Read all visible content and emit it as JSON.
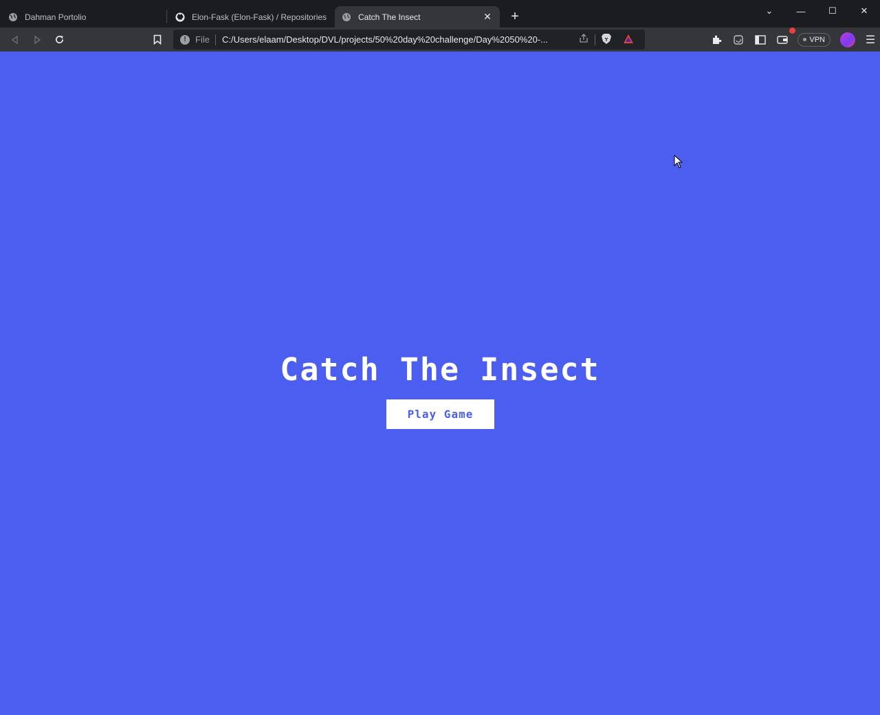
{
  "browser": {
    "tabs": [
      {
        "title": "Dahman Portolio",
        "favicon": "globe-icon",
        "active": false
      },
      {
        "title": "Elon-Fask (Elon-Fask) / Repositories",
        "favicon": "github-icon",
        "active": false
      },
      {
        "title": "Catch The Insect",
        "favicon": "globe-icon",
        "active": true
      }
    ],
    "new_tab": "+",
    "address": {
      "scheme": "File",
      "url": "C:/Users/elaam/Desktop/DVL/projects/50%20day%20challenge/Day%2050%20-..."
    },
    "vpn_label": "VPN"
  },
  "page": {
    "title": "Catch The Insect",
    "play_button": "Play Game",
    "background_color": "#4c5ef0",
    "button_text_color": "#4c5ef0"
  }
}
